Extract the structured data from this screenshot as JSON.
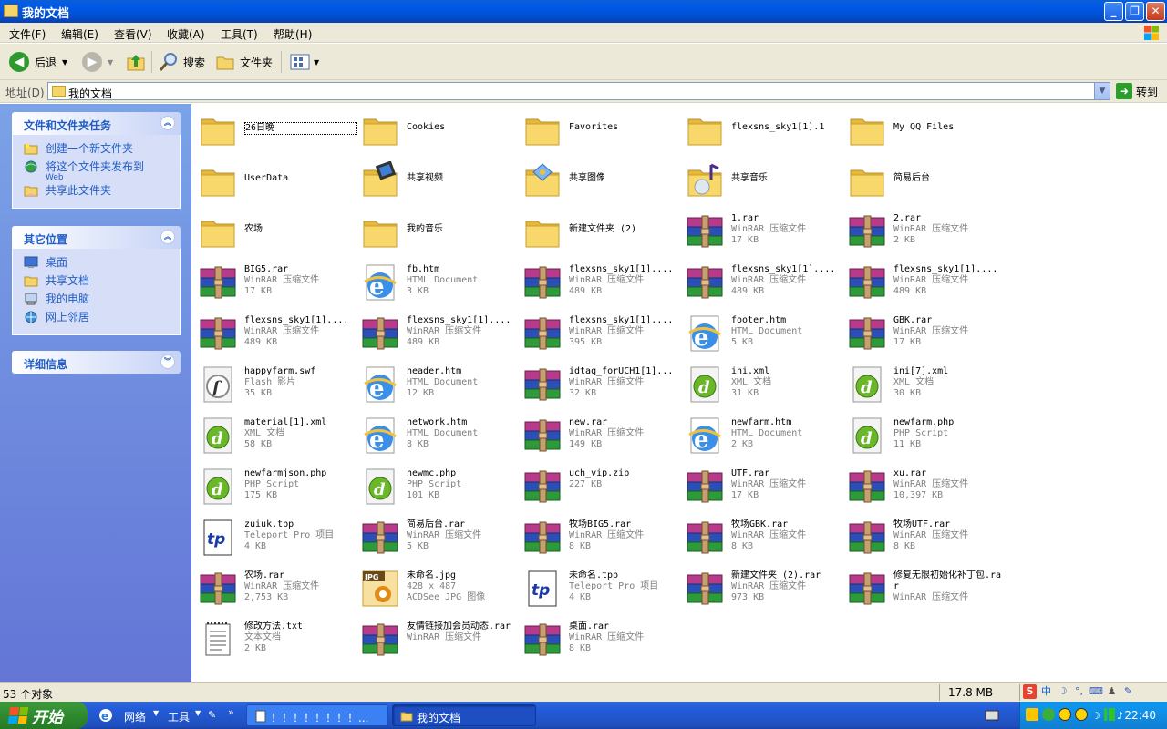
{
  "window": {
    "title": "我的文档"
  },
  "menu": [
    "文件(F)",
    "编辑(E)",
    "查看(V)",
    "收藏(A)",
    "工具(T)",
    "帮助(H)"
  ],
  "toolbar": {
    "back": "后退",
    "search": "搜索",
    "folders": "文件夹"
  },
  "address": {
    "label": "地址(D)",
    "value": "我的文档",
    "go": "转到"
  },
  "taskpane": {
    "tasks": {
      "title": "文件和文件夹任务",
      "items": [
        {
          "label": "创建一个新文件夹",
          "icon": "new-folder-icon"
        },
        {
          "label": "将这个文件夹发布到",
          "sub": "Web",
          "icon": "publish-web-icon"
        },
        {
          "label": "共享此文件夹",
          "icon": "share-folder-icon"
        }
      ]
    },
    "places": {
      "title": "其它位置",
      "items": [
        {
          "label": "桌面",
          "icon": "desktop-icon"
        },
        {
          "label": "共享文档",
          "icon": "folder-icon"
        },
        {
          "label": "我的电脑",
          "icon": "my-computer-icon"
        },
        {
          "label": "网上邻居",
          "icon": "network-icon"
        }
      ]
    },
    "details": {
      "title": "详细信息"
    }
  },
  "files": [
    {
      "name": "26日晚",
      "type": "folder"
    },
    {
      "name": "Cookies",
      "type": "folder"
    },
    {
      "name": "Favorites",
      "type": "folder"
    },
    {
      "name": "flexsns_sky1[1].1",
      "type": "folder"
    },
    {
      "name": "My QQ Files",
      "type": "folder"
    },
    {
      "name": "UserData",
      "type": "folder"
    },
    {
      "name": "共享视频",
      "type": "folder-video"
    },
    {
      "name": "共享图像",
      "type": "folder-image"
    },
    {
      "name": "共享音乐",
      "type": "folder-music"
    },
    {
      "name": "简易后台",
      "type": "folder"
    },
    {
      "name": "农场",
      "type": "folder"
    },
    {
      "name": "我的音乐",
      "type": "folder"
    },
    {
      "name": "新建文件夹 (2)",
      "type": "folder"
    },
    {
      "name": "1.rar",
      "type": "rar",
      "desc": "WinRAR 压缩文件",
      "size": "17 KB"
    },
    {
      "name": "2.rar",
      "type": "rar",
      "desc": "WinRAR 压缩文件",
      "size": "2 KB"
    },
    {
      "name": "BIG5.rar",
      "type": "rar",
      "desc": "WinRAR 压缩文件",
      "size": "17 KB"
    },
    {
      "name": "fb.htm",
      "type": "htm",
      "desc": "HTML Document",
      "size": "3 KB"
    },
    {
      "name": "flexsns_sky1[1]....",
      "type": "rar",
      "desc": "WinRAR 压缩文件",
      "size": "489 KB"
    },
    {
      "name": "flexsns_sky1[1]....",
      "type": "rar",
      "desc": "WinRAR 压缩文件",
      "size": "489 KB"
    },
    {
      "name": "flexsns_sky1[1]....",
      "type": "rar",
      "desc": "WinRAR 压缩文件",
      "size": "489 KB"
    },
    {
      "name": "flexsns_sky1[1]....",
      "type": "rar",
      "desc": "WinRAR 压缩文件",
      "size": "489 KB"
    },
    {
      "name": "flexsns_sky1[1]....",
      "type": "rar",
      "desc": "WinRAR 压缩文件",
      "size": "489 KB"
    },
    {
      "name": "flexsns_sky1[1]....",
      "type": "rar",
      "desc": "WinRAR 压缩文件",
      "size": "395 KB"
    },
    {
      "name": "footer.htm",
      "type": "htm",
      "desc": "HTML Document",
      "size": "5 KB"
    },
    {
      "name": "GBK.rar",
      "type": "rar",
      "desc": "WinRAR 压缩文件",
      "size": "17 KB"
    },
    {
      "name": "happyfarm.swf",
      "type": "swf",
      "desc": "Flash 影片",
      "size": "35 KB"
    },
    {
      "name": "header.htm",
      "type": "htm",
      "desc": "HTML Document",
      "size": "12 KB"
    },
    {
      "name": "idtag_forUCH1[1]...",
      "type": "rar",
      "desc": "WinRAR 压缩文件",
      "size": "32 KB"
    },
    {
      "name": "ini.xml",
      "type": "dw",
      "desc": "XML 文档",
      "size": "31 KB"
    },
    {
      "name": "ini[7].xml",
      "type": "dw",
      "desc": "XML 文档",
      "size": "30 KB"
    },
    {
      "name": "material[1].xml",
      "type": "dw",
      "desc": "XML 文档",
      "size": "58 KB"
    },
    {
      "name": "network.htm",
      "type": "htm",
      "desc": "HTML Document",
      "size": "8 KB"
    },
    {
      "name": "new.rar",
      "type": "rar",
      "desc": "WinRAR 压缩文件",
      "size": "149 KB"
    },
    {
      "name": "newfarm.htm",
      "type": "htm",
      "desc": "HTML Document",
      "size": "2 KB"
    },
    {
      "name": "newfarm.php",
      "type": "dw",
      "desc": "PHP Script",
      "size": "11 KB"
    },
    {
      "name": "newfarmjson.php",
      "type": "dw",
      "desc": "PHP Script",
      "size": "175 KB"
    },
    {
      "name": "newmc.php",
      "type": "dw",
      "desc": "PHP Script",
      "size": "101 KB"
    },
    {
      "name": "uch_vip.zip",
      "type": "rar",
      "desc": "227 KB"
    },
    {
      "name": "UTF.rar",
      "type": "rar",
      "desc": "WinRAR 压缩文件",
      "size": "17 KB"
    },
    {
      "name": "xu.rar",
      "type": "rar",
      "desc": "WinRAR 压缩文件",
      "size": "10,397 KB"
    },
    {
      "name": "zuiuk.tpp",
      "type": "tp",
      "desc": "Teleport Pro 项目",
      "size": "4 KB"
    },
    {
      "name": "简易后台.rar",
      "type": "rar",
      "desc": "WinRAR 压缩文件",
      "size": "5 KB"
    },
    {
      "name": "牧场BIG5.rar",
      "type": "rar",
      "desc": "WinRAR 压缩文件",
      "size": "8 KB"
    },
    {
      "name": "牧场GBK.rar",
      "type": "rar",
      "desc": "WinRAR 压缩文件",
      "size": "8 KB"
    },
    {
      "name": "牧场UTF.rar",
      "type": "rar",
      "desc": "WinRAR 压缩文件",
      "size": "8 KB"
    },
    {
      "name": "农场.rar",
      "type": "rar",
      "desc": "WinRAR 压缩文件",
      "size": "2,753 KB"
    },
    {
      "name": "未命名.jpg",
      "type": "jpg",
      "desc": "428 x 487",
      "size": "ACDSee JPG 图像"
    },
    {
      "name": "未命名.tpp",
      "type": "tp",
      "desc": "Teleport Pro 项目",
      "size": "4 KB"
    },
    {
      "name": "新建文件夹 (2).rar",
      "type": "rar",
      "desc": "WinRAR 压缩文件",
      "size": "973 KB"
    },
    {
      "name": "修复无限初始化补丁包.rar",
      "type": "rar",
      "desc": "WinRAR 压缩文件"
    },
    {
      "name": "修改方法.txt",
      "type": "txt",
      "desc": "文本文档",
      "size": "2 KB"
    },
    {
      "name": "友情链接加会员动态.rar",
      "type": "rar",
      "desc": "WinRAR 压缩文件"
    },
    {
      "name": "桌面.rar",
      "type": "rar",
      "desc": "WinRAR 压缩文件",
      "size": "8 KB"
    }
  ],
  "status": {
    "count": "53 个对象",
    "size": "17.8 MB"
  },
  "taskbar": {
    "start": "开始",
    "quick": [
      "网络",
      "工具"
    ],
    "tasks": [
      "！！！！！！！！...",
      "我的文档"
    ],
    "clock": "22:40"
  }
}
